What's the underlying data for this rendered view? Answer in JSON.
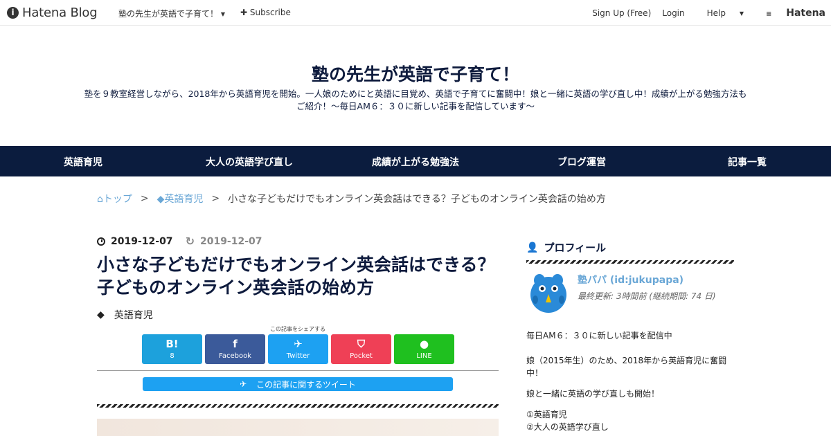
{
  "topbar": {
    "logo_mark": "i",
    "logo_text": "Hatena Blog",
    "blog_name": "塾の先生が英語で子育て！",
    "subscribe": "Subscribe",
    "signup": "Sign Up (Free)",
    "login": "Login",
    "help": "Help",
    "hatena": "Hatena"
  },
  "header": {
    "title": "塾の先生が英語で子育て！",
    "description_line1": "塾を９教室経営しながら、2018年から英語育児を開始。一人娘のためにと英語に目覚め、英語で子育てに奮闘中！娘と一緒に英語の学び直し中！成績が上がる勉強方法も",
    "description_line2": "ご紹介！～毎日AM６：３０に新しい記事を配信しています～"
  },
  "nav": {
    "items": [
      "英語育児",
      "大人の英語学び直し",
      "成績が上がる勉強法",
      "ブログ運営",
      "記事一覧"
    ]
  },
  "breadcrumb": {
    "top": "トップ",
    "sep": ">",
    "category": "英語育児",
    "current": "小さな子どもだけでもオンライン英会話はできる？子どものオンライン英会話の始め方"
  },
  "article": {
    "published": "2019-12-07",
    "updated": "2019-12-07",
    "title": "小さな子どもだけでもオンライン英会話はできる？子どものオンライン英会話の始め方",
    "category": "英語育児",
    "share_caption": "この記事をシェアする",
    "share": {
      "hatena_icon": "B!",
      "hatena_count": "8",
      "facebook": "Facebook",
      "twitter": "Twitter",
      "pocket": "Pocket",
      "line": "LINE"
    },
    "tweet_bar": "この記事に関するツイート"
  },
  "sidebar": {
    "profile_heading": "プロフィール",
    "name": "塾パパ (id:jukupapa)",
    "last_update": "最終更新: 3時間前 (継続期間: 74 日)",
    "lines": [
      "毎日AM６：３０に新しい記事を配信中",
      "娘（2015年生）のため、2018年から英語育児に奮闘",
      "中！",
      "娘と一緒に英語の学び直しも開始！",
      "①英語育児",
      "②大人の英語学び直し"
    ]
  },
  "colors": {
    "navy": "#0b1c3e",
    "link_blue": "#6aa7d6",
    "hatena_blue": "#1da1dc",
    "facebook": "#3b5a9a",
    "twitter": "#1da1f2",
    "pocket": "#ef4056",
    "line": "#1fc01f"
  }
}
